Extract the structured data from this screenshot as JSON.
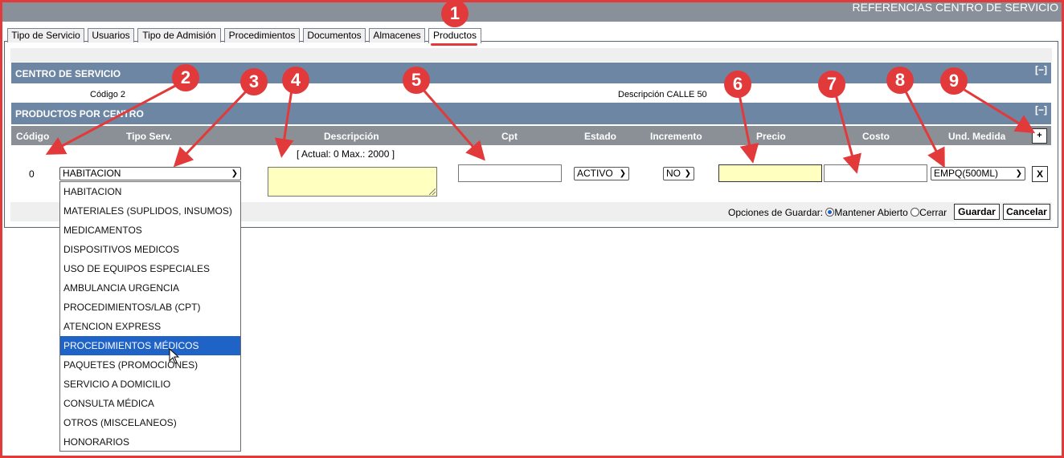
{
  "header": {
    "title": "REFERENCIAS CENTRO DE SERVICIO"
  },
  "tabs": [
    {
      "label": "Tipo de Servicio",
      "active": false
    },
    {
      "label": "Usuarios",
      "active": false
    },
    {
      "label": "Tipo de Admisión",
      "active": false
    },
    {
      "label": "Procedimientos",
      "active": false
    },
    {
      "label": "Documentos",
      "active": false
    },
    {
      "label": "Almacenes",
      "active": false
    },
    {
      "label": "Productos",
      "active": true
    }
  ],
  "center": {
    "section_title": "CENTRO DE SERVICIO",
    "collapse_label": "[−]",
    "code_label": "Código",
    "code_value": "2",
    "desc_label": "Descripción",
    "desc_value": "CALLE 50"
  },
  "products": {
    "section_title": "PRODUCTOS POR CENTRO",
    "collapse_label": "[−]",
    "columns": [
      "Código",
      "Tipo Serv.",
      "Descripción",
      "Cpt",
      "Estado",
      "Incremento",
      "Precio",
      "Costo",
      "Und. Medida"
    ],
    "add_label": "+",
    "counter": "[ Actual: 0   Max.: 2000 ]",
    "row": {
      "codigo": "0",
      "tipo_serv": "HABITACION",
      "estado": "ACTIVO",
      "incremento": "NO",
      "und_medida": "EMPQ(500ML)",
      "remove_label": "X"
    }
  },
  "dropdown": {
    "options": [
      "HABITACION",
      "MATERIALES (SUPLIDOS, INSUMOS)",
      "MEDICAMENTOS",
      "DISPOSITIVOS MEDICOS",
      "USO DE EQUIPOS ESPECIALES",
      "AMBULANCIA URGENCIA",
      "PROCEDIMIENTOS/LAB (CPT)",
      "ATENCION EXPRESS",
      "PROCEDIMIENTOS MÉDICOS",
      "PAQUETES (PROMOCIONES)",
      "SERVICIO A DOMICILIO",
      "CONSULTA MÉDICA",
      "OTROS (MISCELANEOS)",
      "HONORARIOS"
    ],
    "highlighted": "PROCEDIMIENTOS MÉDICOS"
  },
  "save": {
    "options_label": "Opciones de Guardar:",
    "keep_open": "Mantener Abierto",
    "close": "Cerrar",
    "selected": "Mantener Abierto",
    "save_label": "Guardar",
    "cancel_label": "Cancelar"
  },
  "markers": [
    "1",
    "2",
    "3",
    "4",
    "5",
    "6",
    "7",
    "8",
    "9"
  ],
  "colors": {
    "annotation": "#e23a3a",
    "section": "#6c86a4",
    "header": "#8b9097",
    "highlight": "#1f63c6",
    "field_yellow": "#ffffc0"
  }
}
